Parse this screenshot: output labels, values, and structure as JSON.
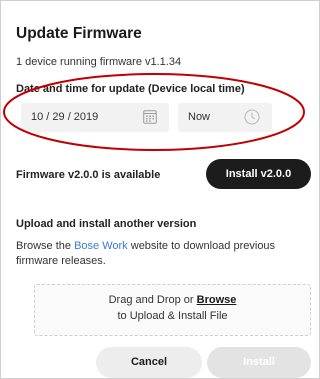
{
  "dialog": {
    "title": "Update Firmware",
    "subtitle": "1 device running firmware v1.1.34"
  },
  "schedule": {
    "label": "Date and time for update (Device local time)",
    "date_value": "10 / 29 / 2019",
    "time_value": "Now",
    "date_icon": "calendar-icon",
    "time_icon": "clock-icon",
    "highlight_color": "#c00000"
  },
  "firmware": {
    "available_text": "Firmware v2.0.0 is available",
    "install_version_label": "Install v2.0.0"
  },
  "upload": {
    "heading": "Upload and install another version",
    "desc_prefix": "Browse the ",
    "desc_link": "Bose Work",
    "desc_suffix": " website to download previous firmware releases.",
    "dropzone_prefix": "Drag and Drop or ",
    "dropzone_link": "Browse",
    "dropzone_line2": "to Upload & Install File"
  },
  "footer": {
    "cancel_label": "Cancel",
    "install_label": "Install"
  },
  "colors": {
    "primary_button": "#1c1c1c",
    "link": "#3a7bd5",
    "disabled_button": "#e3e3e3"
  }
}
